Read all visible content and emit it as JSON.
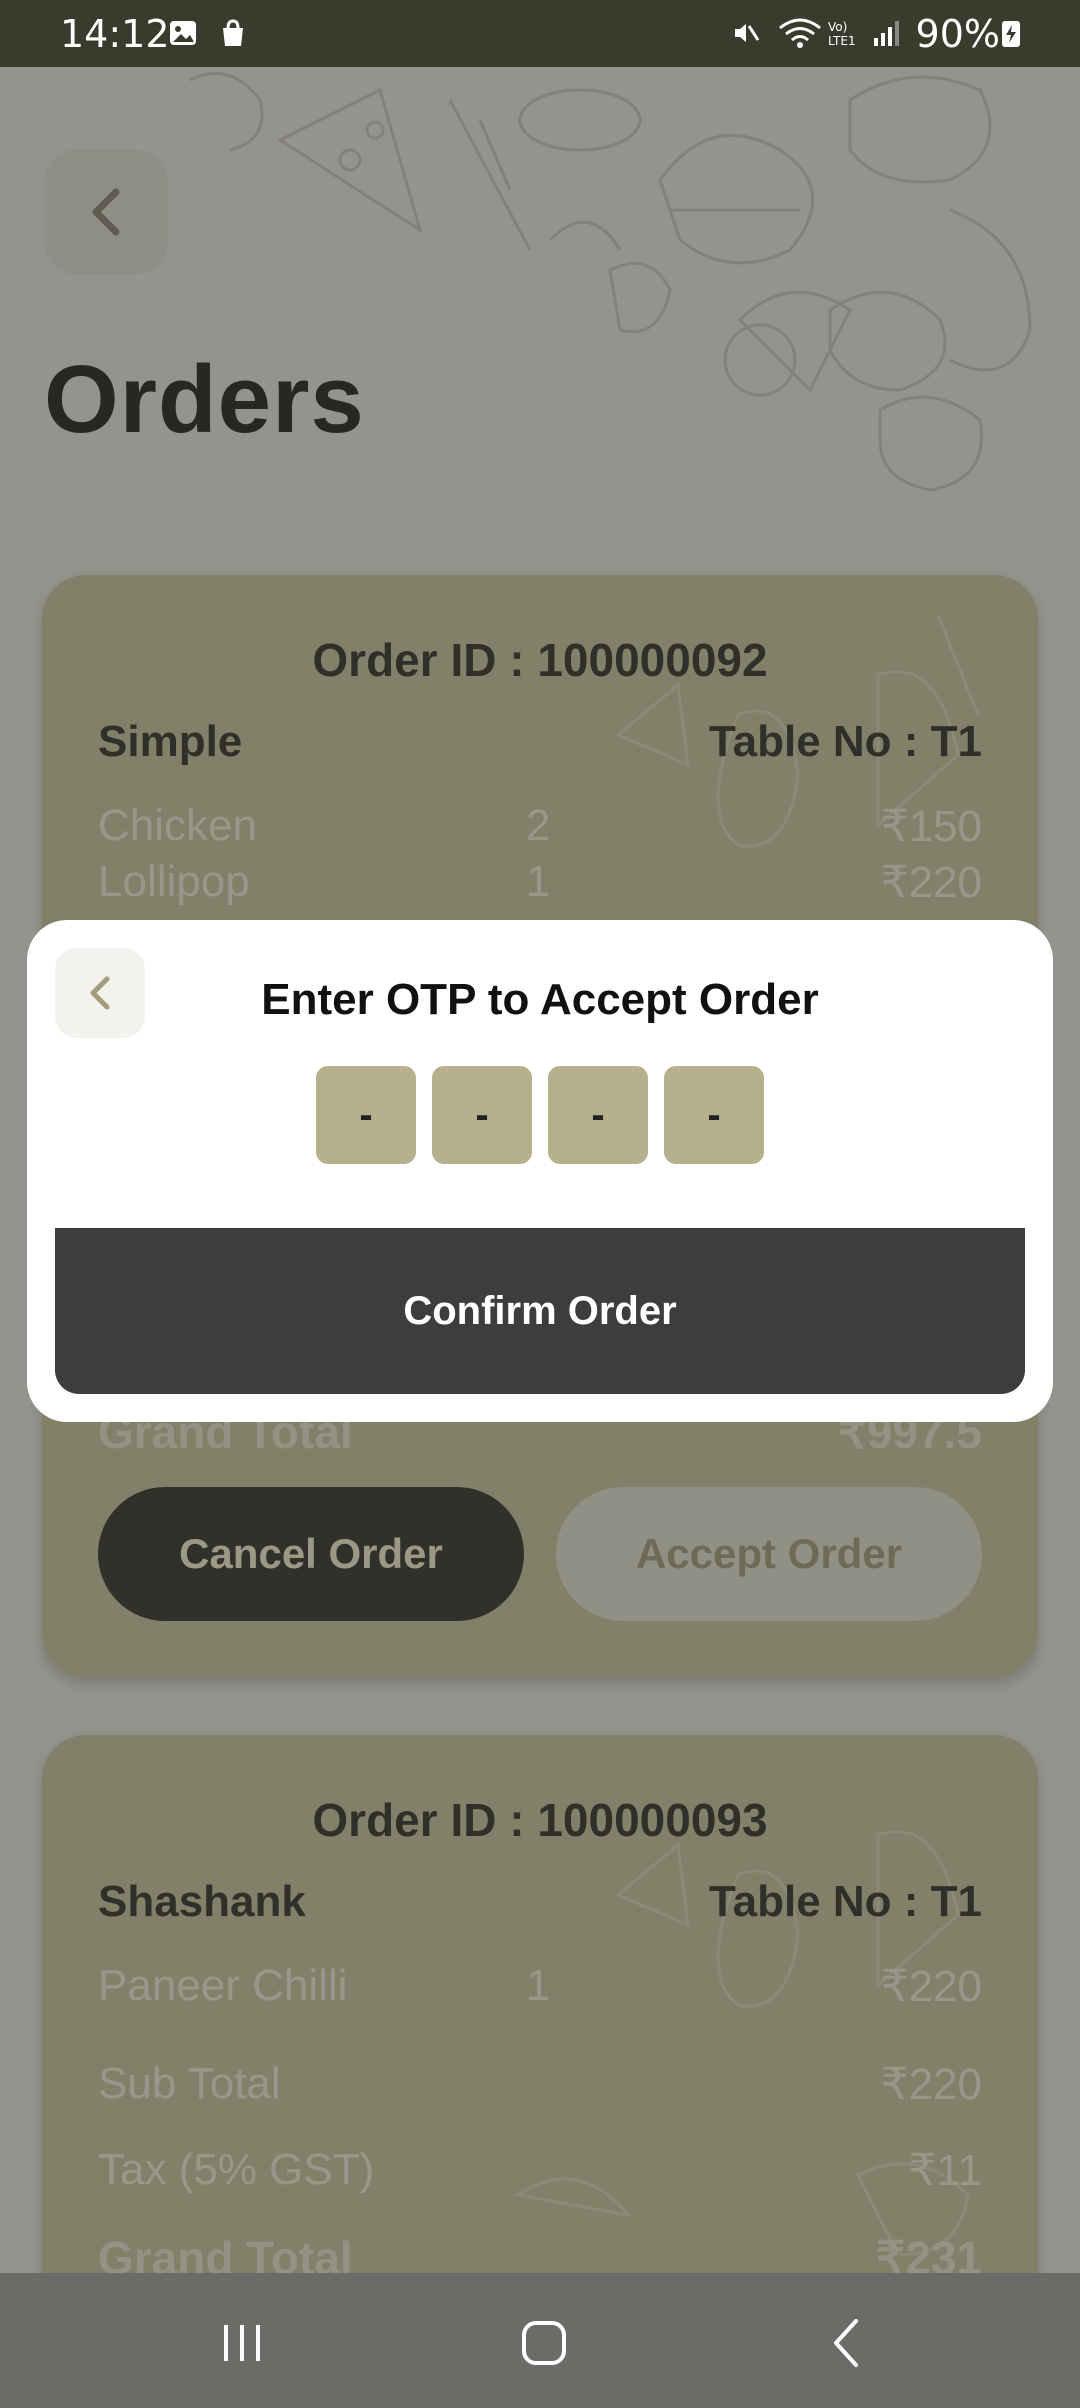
{
  "status_bar": {
    "time": "14:12",
    "battery": "90%",
    "network_label": "Vo) LTE1"
  },
  "header": {
    "title": "Orders",
    "back_icon": "chevron-left-icon"
  },
  "orders": [
    {
      "order_id": "Order ID : 100000092",
      "customer": "Simple",
      "table": "Table No : T1",
      "items": [
        {
          "name": "Chicken",
          "qty": "2",
          "price": "₹150"
        },
        {
          "name": "Lollipop",
          "qty": "1",
          "price": "₹220"
        }
      ],
      "grand_total_label": "Grand Total",
      "grand_total_value": "₹997.5",
      "cancel_label": "Cancel Order",
      "accept_label": "Accept Order"
    },
    {
      "order_id": "Order ID : 100000093",
      "customer": "Shashank",
      "table": "Table No : T1",
      "items": [
        {
          "name": "Paneer Chilli",
          "qty": "1",
          "price": "₹220"
        }
      ],
      "sub_total_label": "Sub Total",
      "sub_total_value": "₹220",
      "tax_label": "Tax (5% GST)",
      "tax_value": "₹11",
      "grand_total_label": "Grand Total",
      "grand_total_value": "₹231"
    }
  ],
  "otp_modal": {
    "title": "Enter OTP to Accept Order",
    "otp_digits": [
      "-",
      "-",
      "-",
      "-"
    ],
    "confirm_label": "Confirm Order"
  },
  "colors": {
    "accent_olive": "#b6b08d",
    "dark_button": "#131313",
    "confirm_button": "#3d3d3d",
    "status_bar": "#3b3b2d"
  }
}
